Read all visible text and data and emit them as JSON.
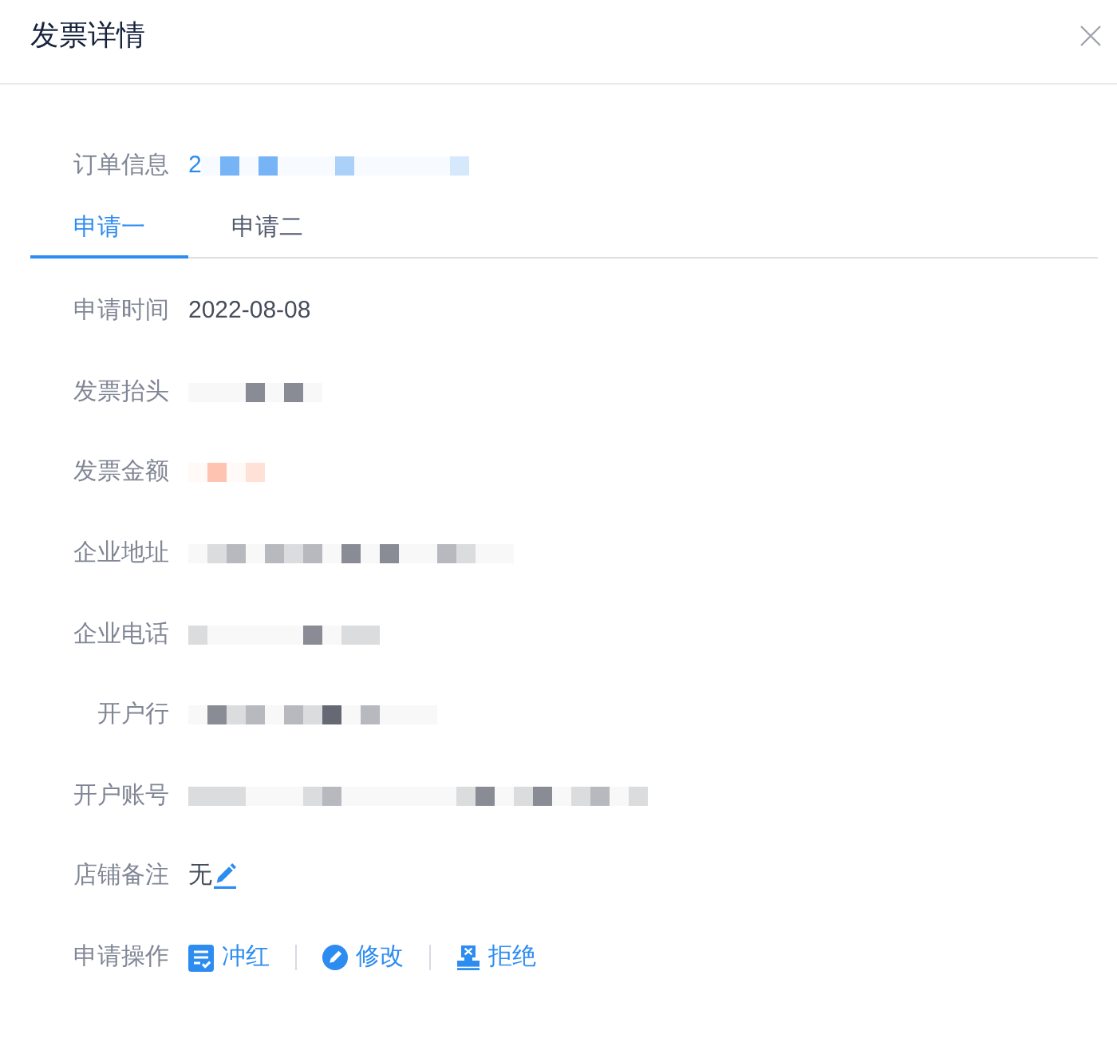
{
  "dialog": {
    "title": "发票详情"
  },
  "order_info": {
    "label": "订单信息",
    "value": "2",
    "redacted": true
  },
  "tabs": [
    {
      "label": "申请一",
      "selected": true
    },
    {
      "label": "申请二",
      "selected": false
    }
  ],
  "fields": [
    {
      "label": "申请时间",
      "kind": "text",
      "value": "2022-08-08",
      "redacted": false
    },
    {
      "label": "发票抬头",
      "kind": "text",
      "redacted": true
    },
    {
      "label": "发票金额",
      "kind": "amount",
      "redacted": true
    },
    {
      "label": "企业地址",
      "kind": "text",
      "redacted": true
    },
    {
      "label": "企业电话",
      "kind": "text",
      "redacted": true
    },
    {
      "label": "开户行",
      "kind": "text",
      "redacted": true
    },
    {
      "label": "开户账号",
      "kind": "text",
      "redacted": true
    },
    {
      "label": "店铺备注",
      "kind": "note",
      "value": "无",
      "redacted": false,
      "editable": true
    }
  ],
  "actions": {
    "label": "申请操作",
    "items": [
      {
        "kind": "reverse",
        "label": "冲红"
      },
      {
        "kind": "edit",
        "label": "修改"
      },
      {
        "kind": "reject",
        "label": "拒绝"
      }
    ]
  }
}
